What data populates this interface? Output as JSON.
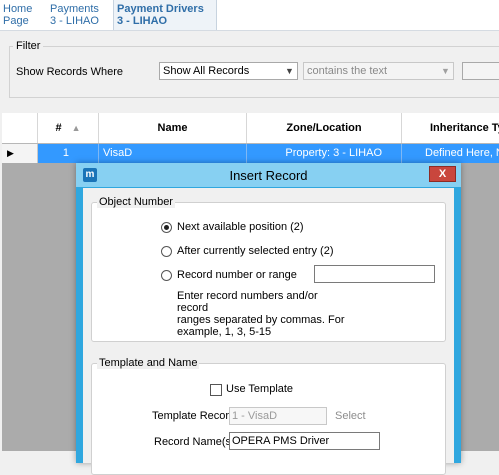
{
  "tabs": [
    {
      "line1": "Home",
      "line2": "Page"
    },
    {
      "line1": "Payments",
      "line2": "3 - LIHAO"
    },
    {
      "line1": "Payment Drivers",
      "line2": "3 - LIHAO"
    }
  ],
  "filter": {
    "legend": "Filter",
    "show_label": "Show Records Where",
    "field_combo": "Show All Records",
    "operator_combo": "contains the text",
    "value": ""
  },
  "grid": {
    "columns": [
      "#",
      "Name",
      "Zone/Location",
      "Inheritance Ty"
    ],
    "rows": [
      {
        "num": "1",
        "name": "VisaD",
        "zone": "Property: 3 - LIHAO",
        "inheritance": "Defined Here, No"
      }
    ]
  },
  "dialog": {
    "icon_letter": "m",
    "title": "Insert Record",
    "close": "X",
    "object_number": {
      "legend": "Object Number",
      "option_next": "Next available position (2)",
      "option_after": "After currently selected entry (2)",
      "option_range": "Record number or range",
      "range_value": "",
      "help_line1": "Enter record numbers and/or record",
      "help_line2": "ranges separated by commas. For",
      "help_line3": "example, 1, 3, 5-15"
    },
    "template_name": {
      "legend": "Template and Name",
      "use_template": "Use Template",
      "template_record_label": "Template Record",
      "template_record_value": "1 - VisaD",
      "select_link": "Select",
      "record_name_label": "Record Name(s)",
      "record_name_value": "OPERA PMS Driver"
    }
  },
  "colors": {
    "tab_text": "#2f6ea8",
    "selection": "#3399ff",
    "dialog_frame": "#2fa7df",
    "titlebar": "#87d0f2",
    "close_button": "#c9463d"
  }
}
